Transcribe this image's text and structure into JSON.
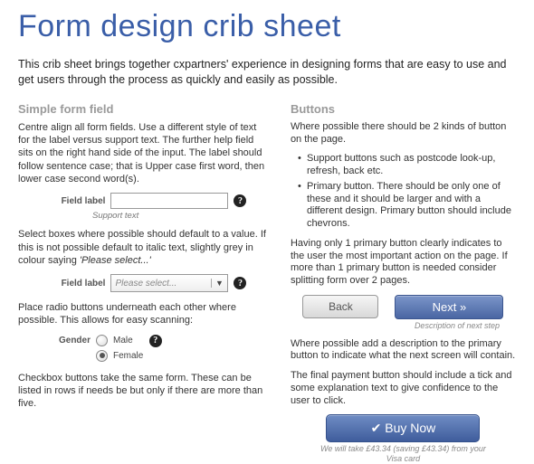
{
  "title": "Form design crib sheet",
  "intro": "This crib sheet brings together cxpartners' experience in designing forms that are easy to use and get users through the process as quickly and easily as possible.",
  "left": {
    "heading": "Simple form field",
    "p1": "Centre align all form fields. Use a different style of text for the label versus support text. The further help field sits on the right hand side of the input.  The label should follow sentence case; that is Upper case first word, then lower case second word(s).",
    "field1": {
      "label": "Field label",
      "support": "Support text"
    },
    "p2a": "Select boxes where possible should default to a value. If this is not possible default to italic text, slightly grey in colour saying ",
    "p2b": "'Please select...'",
    "field2": {
      "label": "Field label",
      "placeholder": "Please select..."
    },
    "p3": "Place radio buttons underneath each other where possible.  This allows for easy scanning:",
    "radios": {
      "label": "Gender",
      "opt1": "Male",
      "opt2": "Female"
    },
    "p4": "Checkbox buttons take the same form.  These can be listed in rows if needs be but only if there are more than five."
  },
  "right": {
    "heading": "Buttons",
    "p1": "Where possible there should be 2 kinds of button on the page.",
    "li1": "Support buttons such as postcode look-up, refresh, back etc.",
    "li2": "Primary button.  There should be only one of these and it should be larger and with a different design. Primary button should include chevrons.",
    "p2": "Having only 1 primary button clearly indicates to the user the most important action on the page.  If more than 1 primary button is needed consider splitting form over 2 pages.",
    "back": "Back",
    "next": "Next »",
    "next_caption": "Description of next step",
    "p3": "Where possible add a description to the primary button to indicate what the next screen will contain.",
    "p4": "The final payment button should include a tick and some explanation text to give confidence to the user to click.",
    "buy": "✔ Buy Now",
    "buy_caption1": "We will take £43.34  (saving £43.34) from your",
    "buy_caption2": "Visa card"
  }
}
